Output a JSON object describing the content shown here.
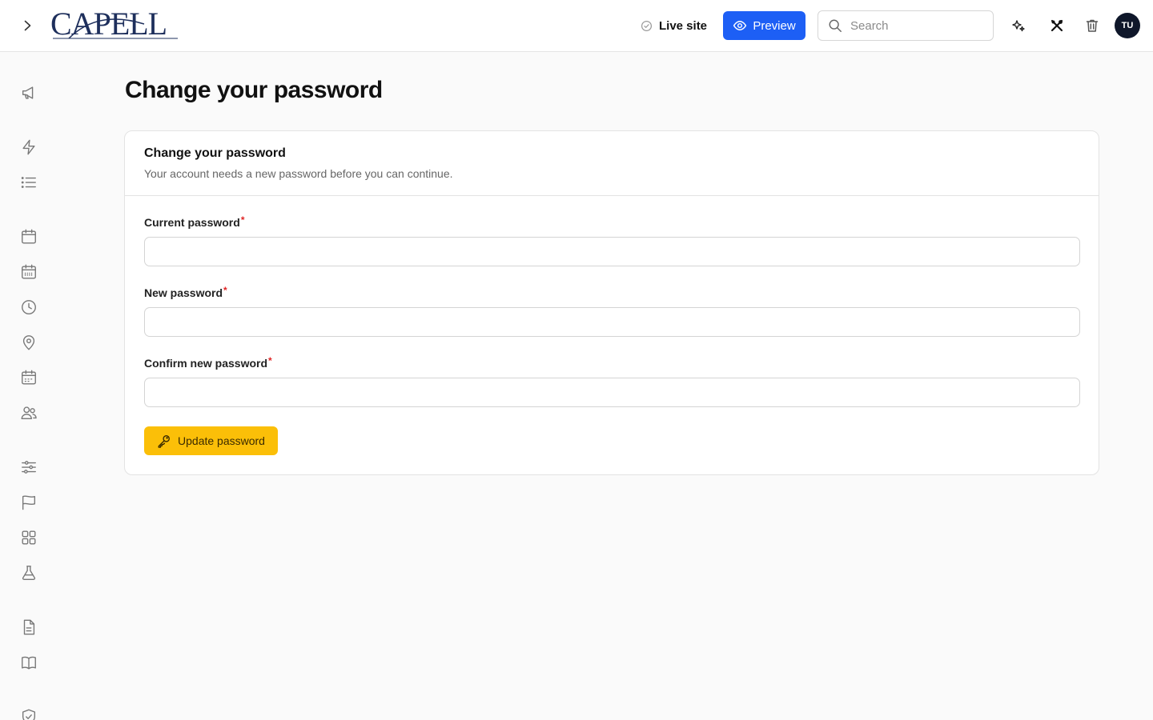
{
  "header": {
    "logo_text": "CAPELL",
    "live_site_label": "Live site",
    "preview_label": "Preview",
    "search": {
      "placeholder": "Search",
      "value": ""
    },
    "avatar_initials": "TU"
  },
  "sidebar": {
    "icons": [
      "megaphone-icon",
      "bolt-icon",
      "list-icon",
      "calendar-icon",
      "calendar-grid-icon",
      "clock-icon",
      "map-pin-icon",
      "calendar-dates-icon",
      "users-icon",
      "sliders-icon",
      "flag-icon",
      "grid-icon",
      "flask-icon",
      "document-icon",
      "book-icon",
      "shield-check-icon"
    ]
  },
  "page": {
    "title": "Change your password"
  },
  "form": {
    "title": "Change your password",
    "subtitle": "Your account needs a new password before you can continue.",
    "fields": [
      {
        "label": "Current password",
        "required_mark": "*",
        "value": ""
      },
      {
        "label": "New password",
        "required_mark": "*",
        "value": ""
      },
      {
        "label": "Confirm new password",
        "required_mark": "*",
        "value": ""
      }
    ],
    "submit_label": "Update password"
  },
  "colors": {
    "accent": "#1d5ff5",
    "submit": "#fbbf08",
    "required": "#e02424",
    "logo": "#1e2f5c"
  }
}
